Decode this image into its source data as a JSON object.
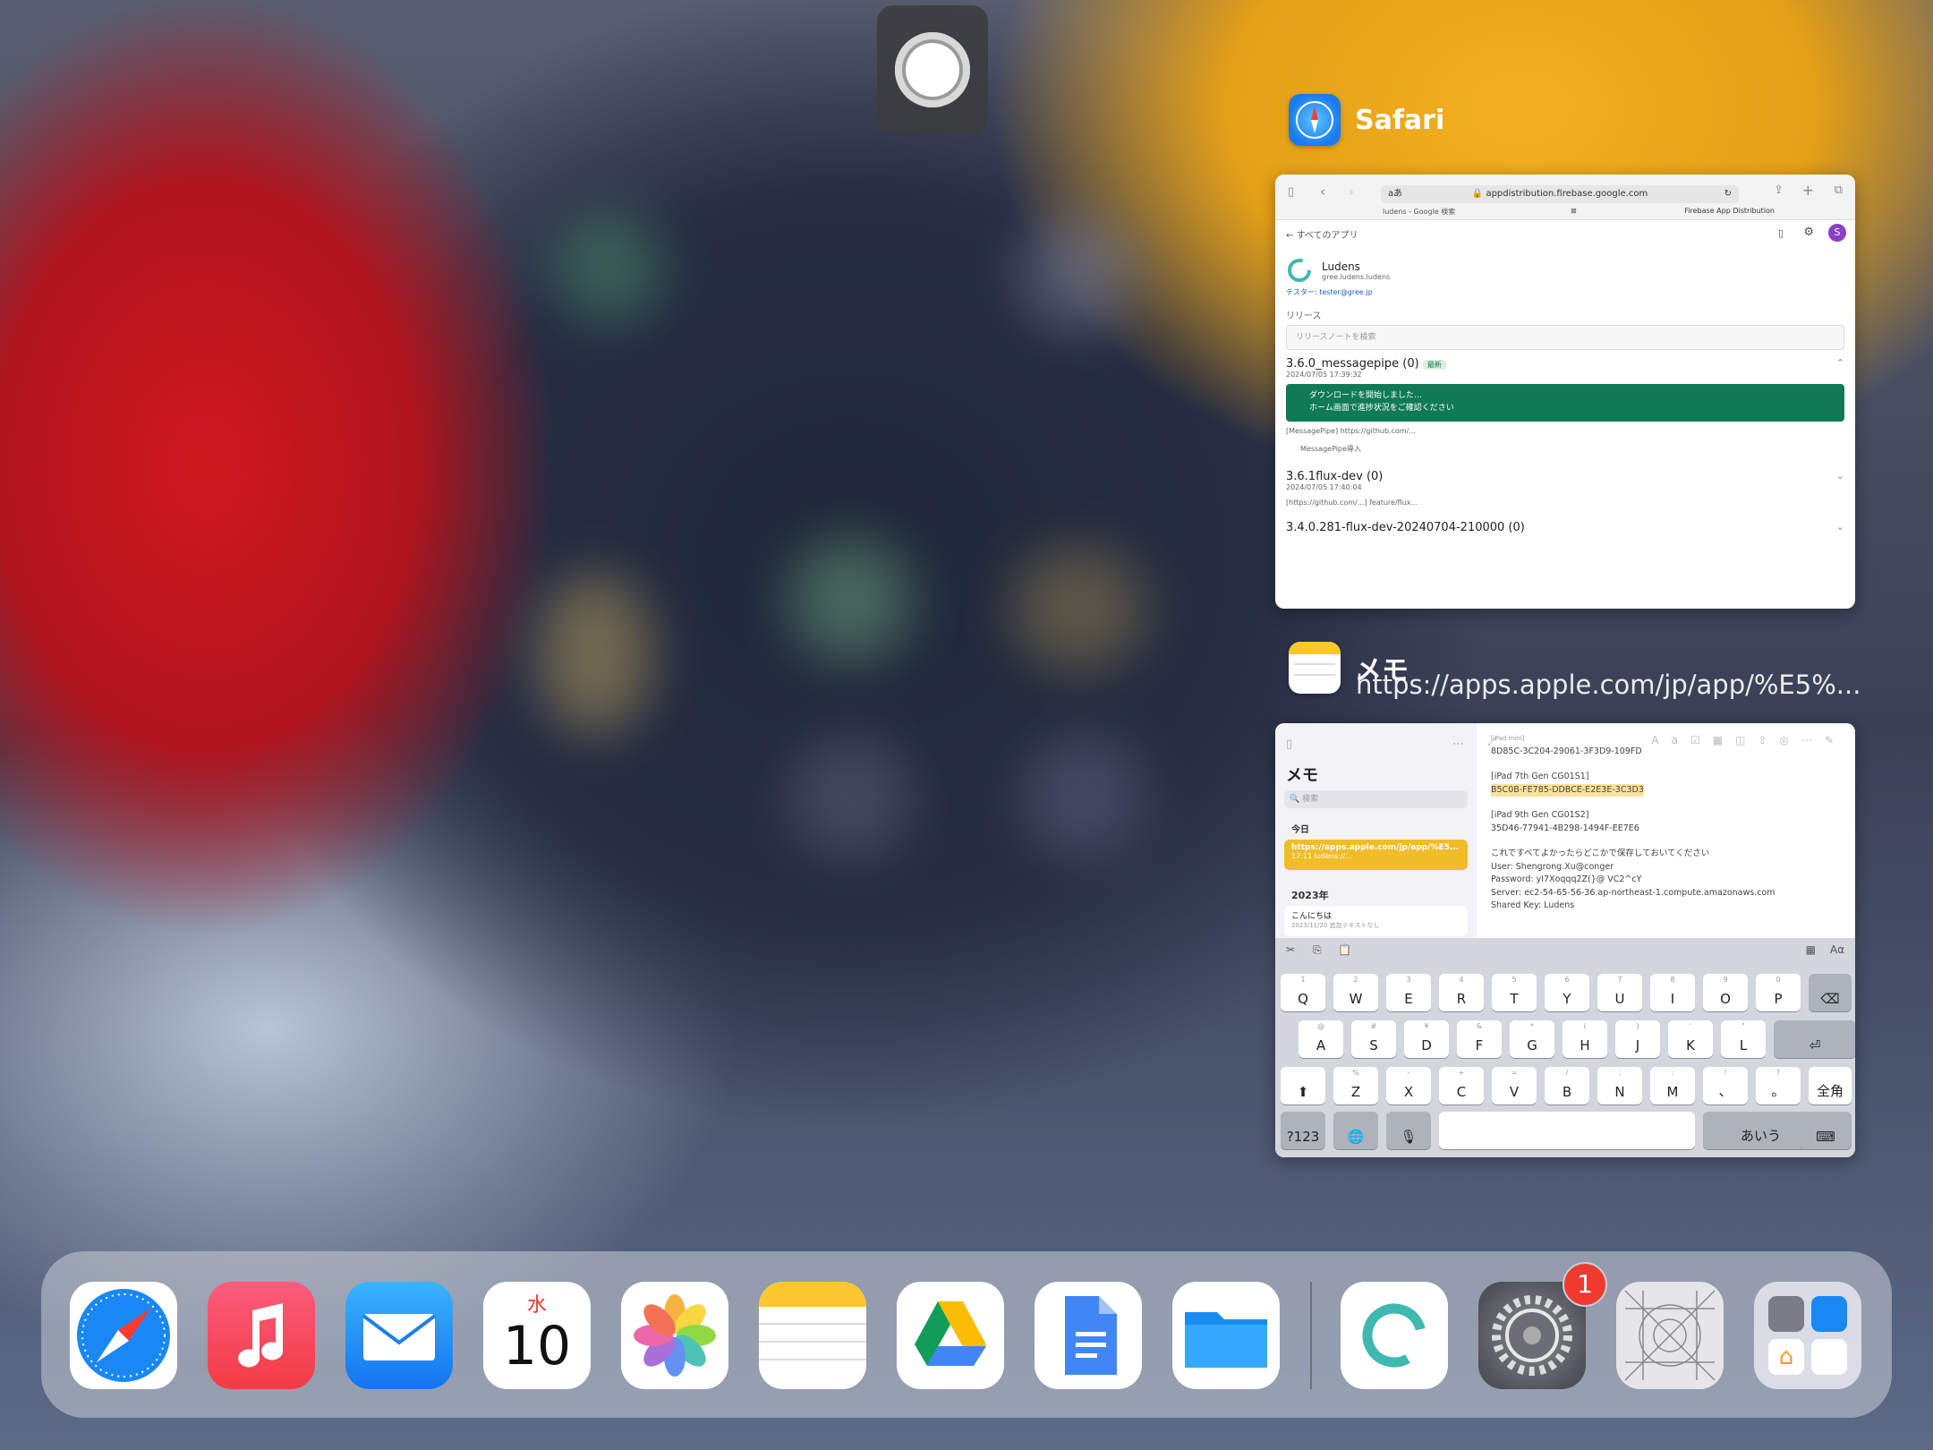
{
  "app_switcher": {
    "safari": {
      "name": "Safari",
      "url": "appdistribution.firebase.google.com",
      "url_prefix": "aあ",
      "tab_left": "ludens - Google 検索",
      "tab_right": "Firebase App Distribution",
      "back_label": "すべてのアプリ",
      "app_name": "Ludens",
      "app_id": "gree.ludens.ludens",
      "tester_label": "テスター: tester@gree.jp",
      "releases_label": "リリース",
      "release_search_placeholder": "リリースノートを検索",
      "releases": [
        {
          "version": "3.6.0_messagepipe (0)",
          "tag": "最新",
          "date": "2024/07/05 17:39:32"
        },
        {
          "version": "3.6.1flux-dev (0)",
          "date": "2024/07/05 17:40:04"
        },
        {
          "version": "3.4.0.281-flux-dev-20240704-210000 (0)"
        }
      ],
      "download_banner_line1": "ダウンロードを開始しました…",
      "download_banner_line2": "ホーム画面で進捗状況をご確認ください",
      "note_1": "[MessagePipe] https://github.com/...",
      "note_2": "MessagePipe導入",
      "note_3": "[https://github.com/...] feature/flux..."
    },
    "memo": {
      "name": "メモ",
      "subtitle": "https://apps.apple.com/jp/app/%E5%...",
      "sidebar_title": "メモ",
      "search_placeholder": "検索",
      "section_today": "今日",
      "selected_note_title": "https://apps.apple.com/jp/app/%E5...",
      "selected_note_sub": "17:11  ludens://...",
      "section_2023": "2023年",
      "other_note_title": "こんにちは",
      "other_note_sub": "2023/11/20  追加テキストなし",
      "body_lines": [
        "[iPad mini]",
        "8D85C-3C204-29061-3F3D9-109FD",
        "",
        "[iPad 7th Gen CG01S1]",
        "B5C0B-FE785-DDBCE-E2E3E-3C3D3",
        "",
        "[iPad 9th Gen CG01S2]",
        " 35D46-77941-4B298-1494F-EE7E6",
        "",
        "これですべてよかったらどこかで保存しておいてください",
        "User: Shengrong.Xu@conger",
        "Password: yI7Xoqqq2Z(}@ VC2^cY",
        "Server: ec2-54-65-56-36.ap-northeast-1.compute.amazonaws.com",
        "Shared Key: Ludens"
      ],
      "keyboard": {
        "row1": [
          "Q",
          "W",
          "E",
          "R",
          "T",
          "Y",
          "U",
          "I",
          "O",
          "P"
        ],
        "row1_hints": [
          "1",
          "2",
          "3",
          "4",
          "5",
          "6",
          "7",
          "8",
          "9",
          "0"
        ],
        "row2": [
          "A",
          "S",
          "D",
          "F",
          "G",
          "H",
          "J",
          "K",
          "L"
        ],
        "row2_hints": [
          "@",
          "#",
          "¥",
          "&",
          "*",
          "(",
          ")",
          "'",
          "\""
        ],
        "row3": [
          "Z",
          "X",
          "C",
          "V",
          "B",
          "N",
          "M",
          "、",
          "。"
        ],
        "row3_hints": [
          "%",
          "-",
          "+",
          "=",
          "/",
          ";",
          ":",
          "!",
          "?"
        ],
        "zenkaku": "全角",
        "num_key": "?123",
        "kana_key": "あいう",
        "format_key": "Aα"
      }
    }
  },
  "dock": {
    "calendar_weekday": "水",
    "calendar_day": "10",
    "settings_badge": "1",
    "apps": [
      "Safari",
      "ミュージック",
      "メール",
      "カレンダー",
      "写真",
      "メモ",
      "Google ドライブ",
      "Google ドキュメント",
      "ファイル",
      "Ludens",
      "設定",
      "App Store Connect",
      "フォルダ"
    ]
  }
}
